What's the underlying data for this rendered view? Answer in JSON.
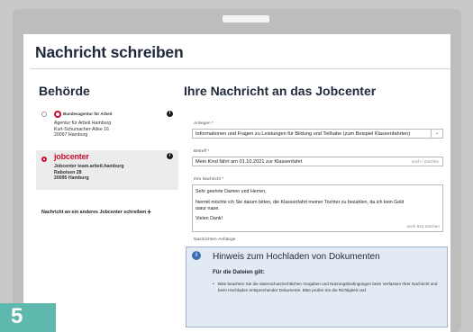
{
  "page_title": "Nachricht schreiben",
  "left": {
    "heading": "Behörde",
    "offices": [
      {
        "brand": "Bundesagentur für Arbeit",
        "lines": [
          "Agentur für Arbeit Hamburg",
          "Kurt-Schumacher-Allee 16",
          "20097 Hamburg"
        ],
        "selected": false
      },
      {
        "brand": "jobcenter",
        "lines": [
          "Jobcenter team.arbeit.hamburg",
          "Raboisen 28",
          "20095 Hamburg"
        ],
        "selected": true
      }
    ],
    "other_link": "Nachricht an ein anderes Jobcenter schreiben"
  },
  "right": {
    "heading": "Ihre Nachricht an das Jobcenter",
    "anliegen_label": "Anliegen *",
    "anliegen_value": "Informationen und Fragen zu Leistungen für Bildung und Teilhabe (zum Beispiel Klassenfahrten)",
    "betreff_label": "Betreff *",
    "betreff_value": "Mein Kind fährt am 01.10.2021 zur Klassenfahrt",
    "betreff_counter": "noch / Zeichen",
    "nachricht_label": "Ihre Nachricht *",
    "message_lines": [
      "Sehr geehrte Damen und Herren,",
      "",
      "hiermit möchte ich Sie darum bitten, die Klassenfahrt meiner Tochter zu bezahlen, da ich kein Geld",
      "dafür habe.",
      "",
      "Vielen Dank!"
    ],
    "message_counter": "noch 844 Zeichen",
    "attachments_label": "Nachrichten-Anhänge",
    "notice": {
      "title": "Hinweis zum Hochladen von Dokumenten",
      "subtitle": "Für die Dateien gilt:",
      "bullet": "Bitte beachten Sie die datenschutzrechtlichen Vorgaben und Nutzungsbedingungen beim Verfassen Ihrer Nachricht und beim Hochladen entsprechender Dokumente. Bitte prüfen Sie die Richtigkeit und"
    }
  },
  "step_badge": "5",
  "colors": {
    "brand_red": "#c8102e",
    "notice_bg": "#e2eaf4",
    "badge_teal": "#5fb8ad"
  }
}
